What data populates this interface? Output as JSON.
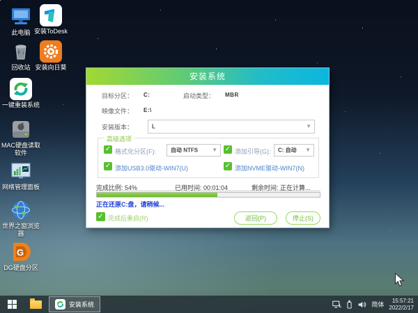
{
  "desktop": {
    "icons": [
      {
        "label": "此电脑"
      },
      {
        "label": "安装ToDesk"
      },
      {
        "label": "回收站"
      },
      {
        "label": "安装向日葵"
      },
      {
        "label": "一键重装系统"
      },
      {
        "label": "MAC硬盘读取软件"
      },
      {
        "label": "网络管理面板"
      },
      {
        "label": "世界之窗浏览器"
      },
      {
        "label": "DG硬盘分区"
      }
    ]
  },
  "dialog": {
    "title": "安装系统",
    "fields": {
      "target_partition_label": "目标分区：",
      "target_partition_value": "C:",
      "boot_type_label": "启动类型：",
      "boot_type_value": "MBR",
      "image_file_label": "映像文件：",
      "image_file_value": "E:\\",
      "install_version_label": "安装版本：",
      "install_version_value": "L"
    },
    "advanced": {
      "group_label": "高级选项",
      "format_label": "格式化分区(F):",
      "format_value": "自动 NTFS",
      "boot_add_label": "添加引导(G):",
      "boot_add_value": "C: 自动",
      "usb3_label": "添加USB3.0驱动-WIN7(U)",
      "nvme_label": "添加NVME驱动-WIN7(N)"
    },
    "progress": {
      "percent": 54,
      "percent_label": "完成比例: 54%",
      "elapsed_label": "已用时间: 00:01:04",
      "remaining_label": "剩余时间: 正在计算...",
      "status_text": "正在还原C:盘，请稍候...",
      "restart_label": "完成后重启(R)",
      "back_button": "返回(P)",
      "stop_button": "停止(S)"
    }
  },
  "taskbar": {
    "task_label": "安装系统",
    "tray_lang": "简体",
    "tray_time": "15:57:21",
    "tray_date": "2022/2/17"
  },
  "colors": {
    "title_gradient_left": "#a3d831",
    "title_gradient_right": "#0cb6e0",
    "accent_green": "#57c02e",
    "progress_green": "#6cbb29",
    "status_blue": "#1f3fd8",
    "link_blue": "#4a82c9",
    "taskbar_bg": "#2a383c"
  }
}
